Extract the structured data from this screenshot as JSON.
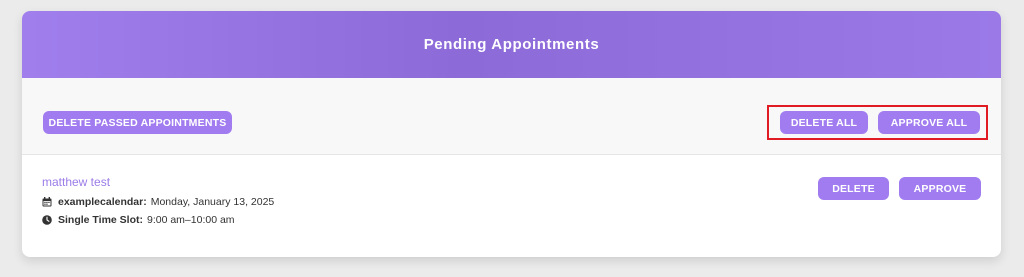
{
  "header": {
    "title": "Pending Appointments"
  },
  "toolbar": {
    "delete_passed_label": "DELETE PASSED APPOINTMENTS",
    "delete_all_label": "DELETE ALL",
    "approve_all_label": "APPROVE ALL"
  },
  "appointments": [
    {
      "name": "matthew test",
      "calendar_label": "examplecalendar:",
      "date": "Monday, January 13, 2025",
      "slot_label": "Single Time Slot:",
      "time": "9:00 am–10:00 am",
      "delete_label": "DELETE",
      "approve_label": "APPROVE"
    }
  ],
  "colors": {
    "accent": "#a17cf0",
    "highlight": "#e01b24"
  },
  "icons": [
    "calendar-icon",
    "clock-icon"
  ]
}
